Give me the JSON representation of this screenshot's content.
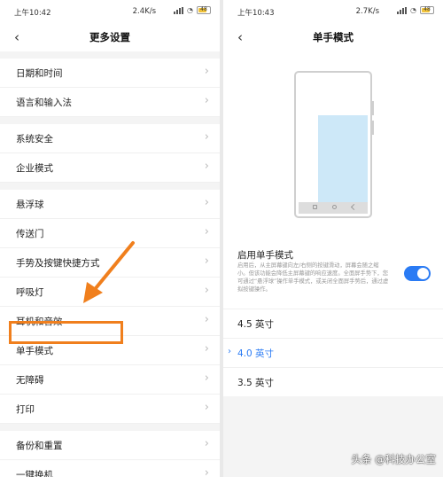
{
  "left": {
    "status": {
      "time": "上午10:42",
      "speed": "2.4K/s",
      "battery": "48"
    },
    "title": "更多设置",
    "groups": [
      [
        "日期和时间",
        "语言和输入法"
      ],
      [
        "系统安全",
        "企业模式"
      ],
      [
        "悬浮球",
        "传送门",
        "手势及按键快捷方式",
        "呼吸灯",
        "耳机和音效",
        "单手模式",
        "无障碍",
        "打印"
      ],
      [
        "备份和重置",
        "一键换机"
      ]
    ]
  },
  "right": {
    "status": {
      "time": "上午10:43",
      "speed": "2.7K/s",
      "battery": "48"
    },
    "title": "单手模式",
    "toggle": {
      "title": "启用单手模式",
      "description": "启用后，从主屏幕键向左/右侧的按键滑动，屏幕会随之缩小。但该功能会降低主屏幕键的响应速度。全面屏手势下，您可通过“悬浮球”操作单手模式，或关闭全面屏手势后，通过虚拟按键操作。",
      "on": true
    },
    "options": [
      "4.5 英寸",
      "4.0 英寸",
      "3.5 英寸"
    ],
    "selected_option": "4.0 英寸"
  },
  "watermark": "头条 @科技办公室",
  "colors": {
    "accent": "#2a7bf4",
    "highlight": "#f07f1d",
    "preview": "#cde8f8"
  },
  "icons": {
    "back": "back-arrow-icon",
    "chevron": "chevron-right-icon",
    "check": "chevron-right-icon"
  }
}
